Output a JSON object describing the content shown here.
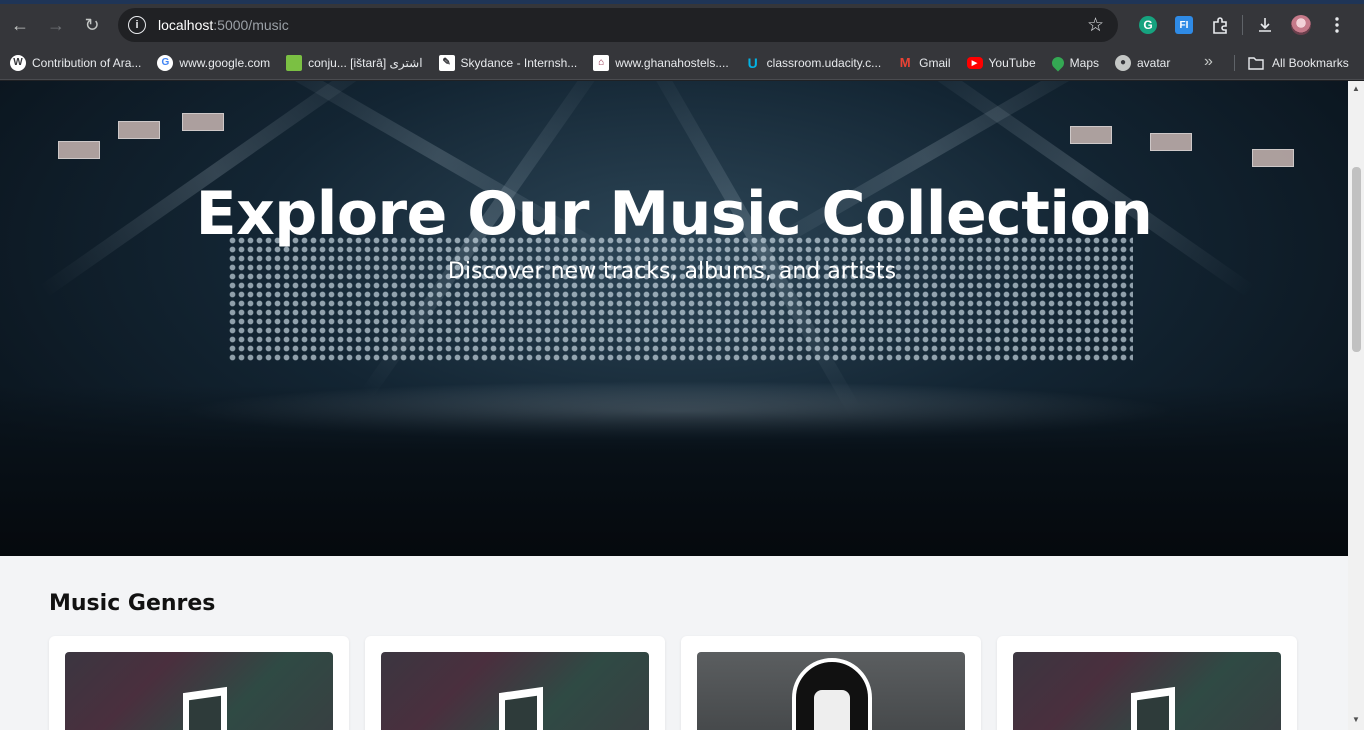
{
  "browser": {
    "url_host": "localhost",
    "url_path": ":5000/music",
    "bookmarks": [
      {
        "label": "Contribution of Ara...",
        "icon": "wordpress-icon",
        "color": "#ffffff"
      },
      {
        "label": "www.google.com",
        "icon": "google-icon",
        "color": "#ffffff"
      },
      {
        "label": "conju... [ištarā] اشترى",
        "icon": "flag-icon",
        "color": "#7bc043"
      },
      {
        "label": "Skydance - Internsh...",
        "icon": "pen-icon",
        "color": "#ffffff"
      },
      {
        "label": "www.ghanahostels....",
        "icon": "hostel-icon",
        "color": "#ffffff"
      },
      {
        "label": "classroom.udacity.c...",
        "icon": "udacity-icon",
        "color": "#02b3e4"
      },
      {
        "label": "Gmail",
        "icon": "gmail-icon",
        "color": "#ea4335"
      },
      {
        "label": "YouTube",
        "icon": "youtube-icon",
        "color": "#ff0000"
      },
      {
        "label": "Maps",
        "icon": "maps-icon",
        "color": "#34a853"
      },
      {
        "label": "avatar",
        "icon": "globe-icon",
        "color": "#c4c7c5"
      }
    ],
    "all_bookmarks_label": "All Bookmarks"
  },
  "hero": {
    "title": "Explore Our Music Collection",
    "subtitle": "Discover new tracks, albums, and artists"
  },
  "genres": {
    "heading": "Music Genres",
    "cards": [
      {
        "image": "music-note-image"
      },
      {
        "image": "music-note-image"
      },
      {
        "image": "mask-photo-image"
      },
      {
        "image": "music-note-image"
      }
    ]
  }
}
